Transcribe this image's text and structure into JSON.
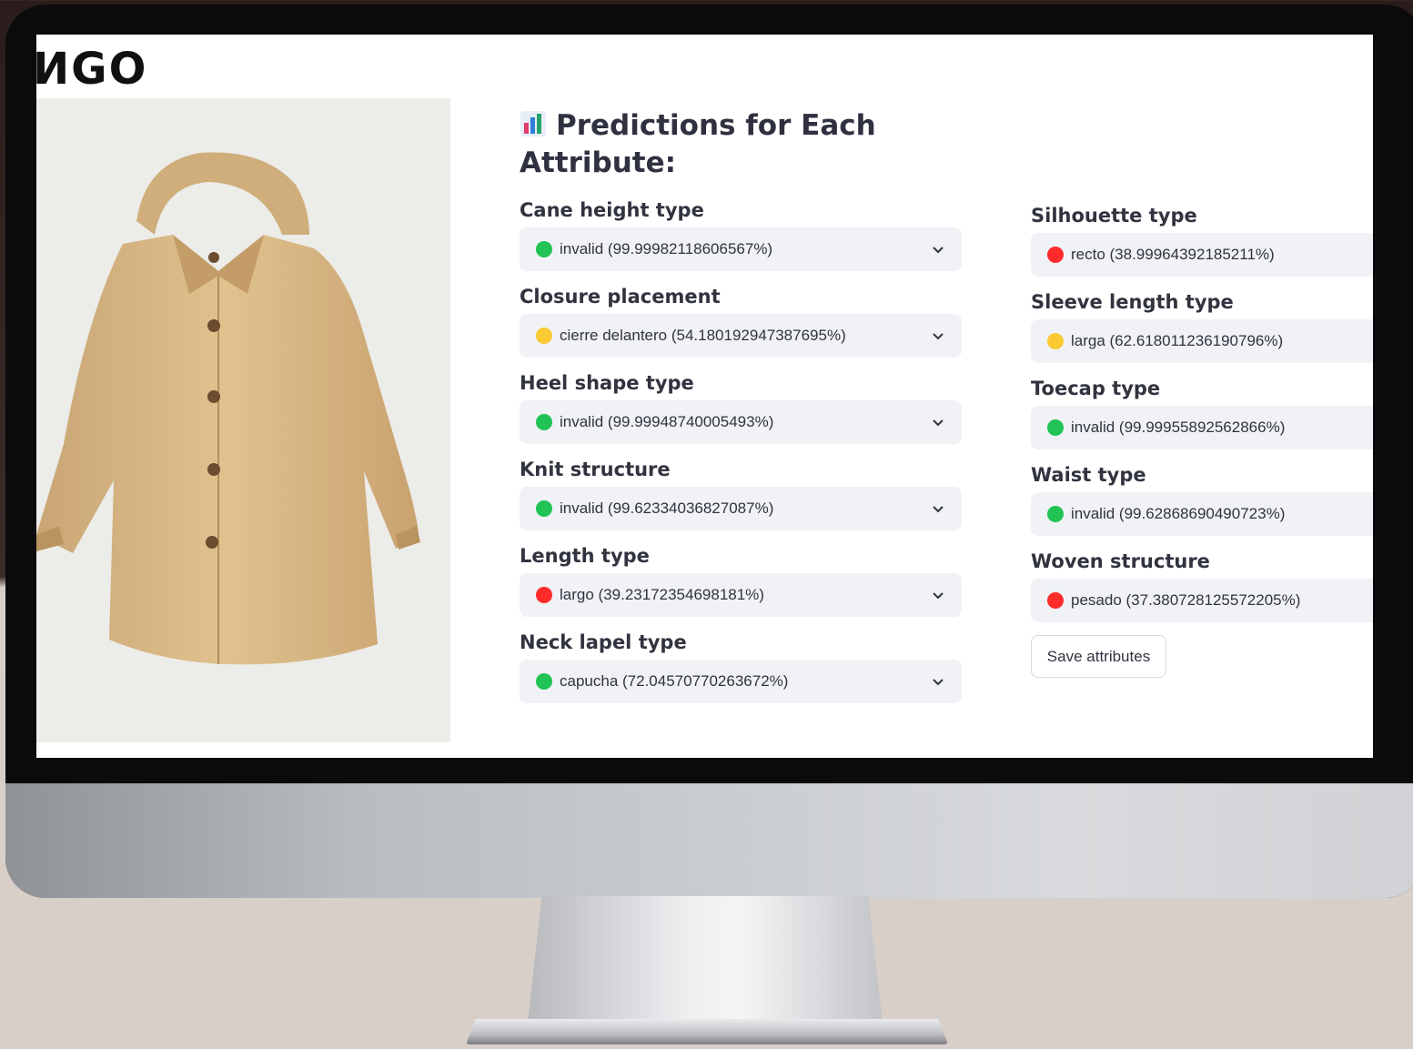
{
  "logo": {
    "text": "ИGO"
  },
  "title": "Predictions for Each Attribute:",
  "colors": {
    "green": "#21c354",
    "yellow": "#fbc932",
    "red": "#ff2b2b"
  },
  "left_fields": [
    {
      "label": "Cane height type",
      "value": "invalid (99.99982118606567%)",
      "status": "green"
    },
    {
      "label": "Closure placement",
      "value": "cierre delantero (54.180192947387695%)",
      "status": "yellow"
    },
    {
      "label": "Heel shape type",
      "value": "invalid (99.99948740005493%)",
      "status": "green"
    },
    {
      "label": "Knit structure",
      "value": "invalid (99.62334036827087%)",
      "status": "green"
    },
    {
      "label": "Length type",
      "value": "largo (39.23172354698181%)",
      "status": "red"
    },
    {
      "label": "Neck lapel type",
      "value": "capucha (72.04570770263672%)",
      "status": "green"
    }
  ],
  "right_fields": [
    {
      "label": "Silhouette type",
      "value": "recto (38.99964392185211%)",
      "status": "red"
    },
    {
      "label": "Sleeve length type",
      "value": "larga (62.618011236190796%)",
      "status": "yellow"
    },
    {
      "label": "Toecap type",
      "value": "invalid (99.99955892562866%)",
      "status": "green"
    },
    {
      "label": "Waist type",
      "value": "invalid (99.62868690490723%)",
      "status": "green"
    },
    {
      "label": "Woven structure",
      "value": "pesado (37.380728125572205%)",
      "status": "red"
    }
  ],
  "save_button": "Save attributes"
}
